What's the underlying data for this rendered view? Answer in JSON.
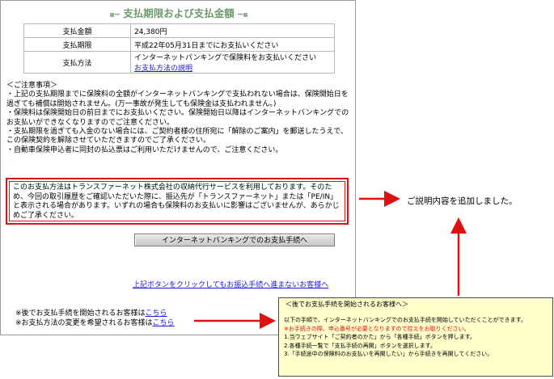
{
  "page_title": "支払期限および支払金額",
  "title_deco_left": "▪━",
  "title_deco_right": "━▪",
  "summary": {
    "rows": [
      {
        "label": "支払金額",
        "value": "24,380円"
      },
      {
        "label": "支払期限",
        "value": "平成22年05月31日までにお支払いください"
      },
      {
        "label": "支払方法",
        "value": "インターネットバンキングで保険料をお支払いください",
        "link": "お支払方法の説明"
      }
    ]
  },
  "notes": {
    "heading": "＜ご注意事項＞",
    "items": [
      "・上記の支払期限までに保険料の全額がインターネットバンキングで支払われない場合は、保険開始日を過ぎても補償は開始されません。(万一事故が発生しても保険金は支払われません。)",
      "・保険料は保険開始日の前日までにお支払いください。保険開始日以降はインターネットバンキングでのお支払いができなくなりますのでご注意ください。",
      "・支払期限を過ぎても入金のない場合には、ご契約者様の住所宛に「解除のご案内」を郵送したうえで、この保険契約を解除させていただきますのでご了承ください。",
      "・自動車保険申込者に同封の払込票はご利用いただけませんので、ご注意ください。"
    ]
  },
  "highlight_notice": "このお支払方法はトランスファーネット株式会社の収納代行サービスを利用しております。そのため、今回の取引履歴をご確認いただいた際に、振込先が「トランスファーネット」または「PE/IN」と表示される場合があります。いずれの場合も保険料のお支払いに影響はございませんが、あらかじめご了承ください。",
  "proceed_button": "インターネットバンキングでのお支払手続へ",
  "below_link": "上記ボタンをクリックしてもお振込手続へ進まないお客様へ",
  "later": {
    "line1_text": "※後でお支払手続を開始されるお客様は",
    "line1_link": "こちら",
    "line2_text": "※お支払方法の変更を希望されるお客様は",
    "line2_link": "こちら"
  },
  "callout_text": "ご説明内容を追加しました。",
  "popup": {
    "heading": "＜後でお支払手続を開始されるお客様へ＞",
    "line1": "以下の手順で、インターネットバンキングでのお支払手続を開始していただくことができます。",
    "line2": "※お手続きの際、申込番号が必要となりますので控えをお取りください。",
    "line3": "1.当ウェブサイト「ご契約者のかた」から「各種手続」ボタンを押します。",
    "line4": "2.各種手続一覧で「支払手続の再開」ボタンを選択します。",
    "line5": "3.「手続途中の保険料のお支払いを再開したい」から手続きを再開してください。"
  },
  "colors": {
    "title": "#6e9a6e",
    "highlight_border": "#e01010",
    "link": "#1a1adb",
    "popup_bg": "#ffffcc",
    "popup_warning": "#e01010"
  }
}
